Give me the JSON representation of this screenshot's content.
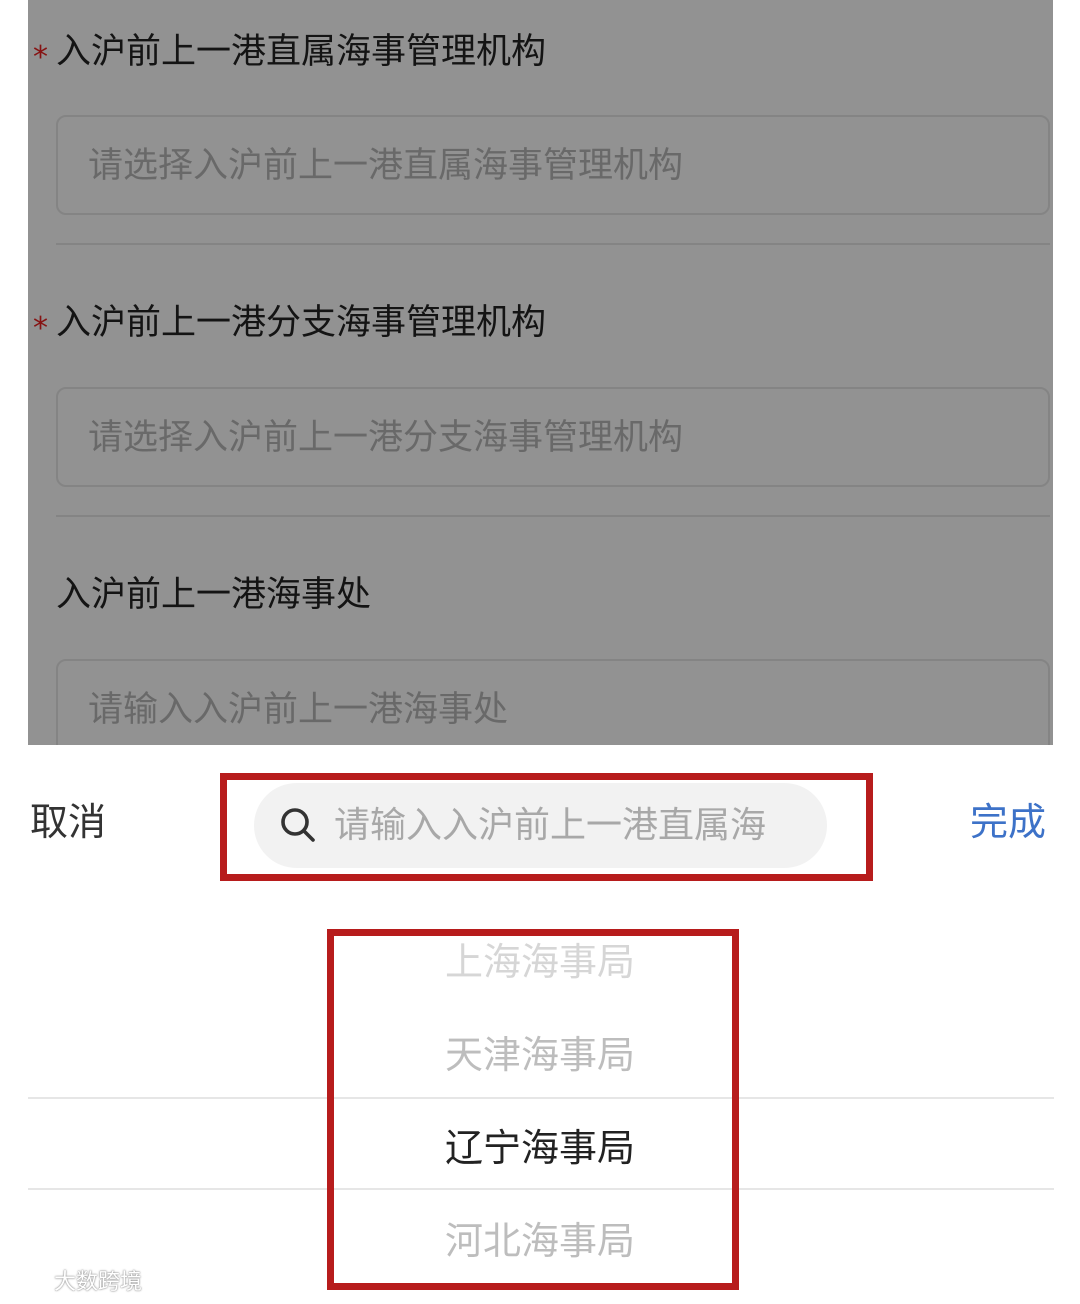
{
  "form": {
    "fields": [
      {
        "label": "入沪前上一港直属海事管理机构",
        "required": "*",
        "placeholder": "请选择入沪前上一港直属海事管理机构"
      },
      {
        "label": "入沪前上一港分支海事管理机构",
        "required": "*",
        "placeholder": "请选择入沪前上一港分支海事管理机构"
      },
      {
        "label": "入沪前上一港海事处",
        "placeholder": "请输入入沪前上一港海事处"
      }
    ]
  },
  "picker": {
    "cancel_label": "取消",
    "done_label": "完成",
    "search": {
      "placeholder": "请输入入沪前上一港直属海",
      "icon": "search-icon"
    },
    "options": [
      "上海海事局",
      "天津海事局",
      "辽宁海事局",
      "河北海事局"
    ],
    "selected": "辽宁海事局"
  },
  "watermark": {
    "text": "大数跨境"
  },
  "colors": {
    "required": "#e02020",
    "done": "#3d72c8",
    "highlight_border": "#b71c1c"
  }
}
